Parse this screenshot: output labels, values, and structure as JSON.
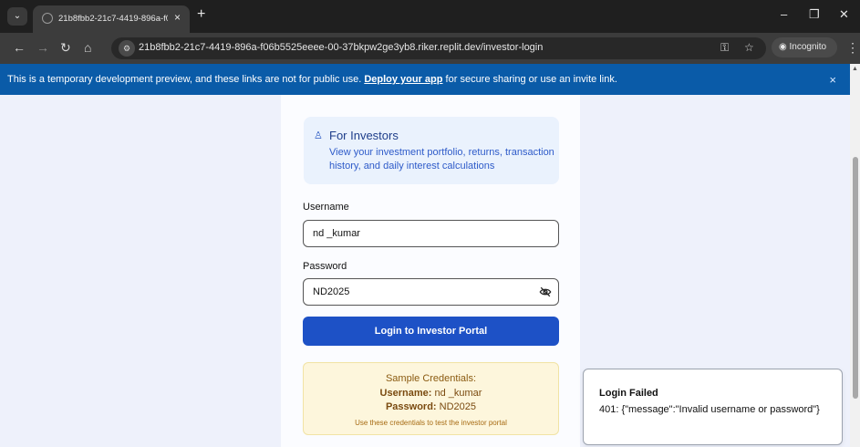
{
  "browser": {
    "tab_title": "21b8fbb2-21c7-4419-896a-f06b",
    "new_tab": "+",
    "tab_close": "×",
    "url": "21b8fbb2-21c7-4419-896a-f06b5525eeee-00-37bkpw2ge3yb8.riker.replit.dev/investor-login",
    "incognito_label": "Incognito",
    "window_controls": [
      "–",
      "❐",
      "✕"
    ]
  },
  "banner": {
    "text_before": "This is a temporary development preview, and these links are not for public use. ",
    "link": "Deploy your app",
    "text_after": " for secure sharing or use an invite link.",
    "close": "×"
  },
  "info": {
    "title": "For Investors",
    "description": "View your investment portfolio, returns, transaction history, and daily interest calculations"
  },
  "form": {
    "username_label": "Username",
    "username_value": "nd _kumar",
    "password_label": "Password",
    "password_value": "ND2025",
    "submit_label": "Login to Investor Portal"
  },
  "credentials": {
    "title": "Sample Credentials:",
    "username_key": "Username:",
    "username_value": " nd _kumar",
    "password_key": "Password:",
    "password_value": " ND2025",
    "note": "Use these credentials to test the investor portal"
  },
  "toast": {
    "title": "Login Failed",
    "message": "401: {\"message\":\"Invalid username or password\"}"
  },
  "colors": {
    "banner": "#0a5ba8",
    "primary_button": "#1d51c6",
    "info_box": "#eaf2fd",
    "credentials_box": "#fdf6dc"
  }
}
